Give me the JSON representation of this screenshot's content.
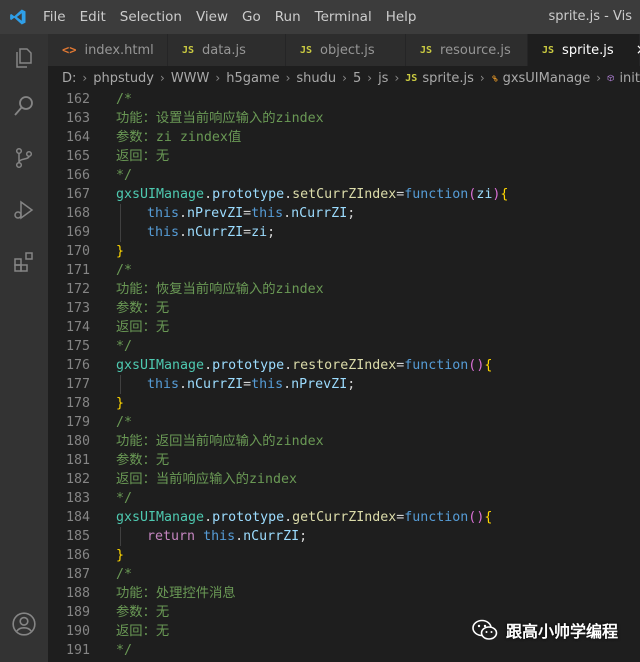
{
  "menu": [
    "File",
    "Edit",
    "Selection",
    "View",
    "Go",
    "Run",
    "Terminal",
    "Help"
  ],
  "window_title": "sprite.js - Vis",
  "tabs": [
    {
      "label": "index.html",
      "icon": "<>",
      "active": false
    },
    {
      "label": "data.js",
      "icon": "JS",
      "active": false
    },
    {
      "label": "object.js",
      "icon": "JS",
      "active": false
    },
    {
      "label": "resource.js",
      "icon": "JS",
      "active": false
    },
    {
      "label": "sprite.js",
      "icon": "JS",
      "active": true
    }
  ],
  "tab_close_glyph": "×",
  "breadcrumb": [
    "D:",
    "phpstudy",
    "WWW",
    "h5game",
    "shudu",
    "5",
    "js",
    "sprite.js",
    "gxsUIManage",
    "init"
  ],
  "activity_icons": [
    "explorer-icon",
    "search-icon",
    "source-control-icon",
    "run-debug-icon",
    "extensions-icon",
    "account-icon"
  ],
  "colors": {
    "accent": "#007acc",
    "editor_bg": "#1e1e1e",
    "comment": "#6a9955",
    "keyword": "#569cd6",
    "class": "#4ec9b0",
    "property": "#9cdcfe",
    "function": "#dcdcaa"
  },
  "editor": {
    "lines": [
      {
        "n": "162",
        "text": "/*"
      },
      {
        "n": "163",
        "text": "功能：设置当前响应输入的zindex"
      },
      {
        "n": "164",
        "text": "参数：zi zindex值"
      },
      {
        "n": "165",
        "text": "返回：无"
      },
      {
        "n": "166",
        "text": "*/"
      },
      {
        "n": "167",
        "text": "gxsUIManage.prototype.setCurrZIndex=function(zi){"
      },
      {
        "n": "168",
        "text": "this.nPrevZI=this.nCurrZI;"
      },
      {
        "n": "169",
        "text": "this.nCurrZI=zi;"
      },
      {
        "n": "170",
        "text": "}"
      },
      {
        "n": "171",
        "text": "/*"
      },
      {
        "n": "172",
        "text": "功能：恢复当前响应输入的zindex"
      },
      {
        "n": "173",
        "text": "参数：无"
      },
      {
        "n": "174",
        "text": "返回：无"
      },
      {
        "n": "175",
        "text": "*/"
      },
      {
        "n": "176",
        "text": "gxsUIManage.prototype.restoreZIndex=function(){"
      },
      {
        "n": "177",
        "text": "this.nCurrZI=this.nPrevZI;"
      },
      {
        "n": "178",
        "text": "}"
      },
      {
        "n": "179",
        "text": "/*"
      },
      {
        "n": "180",
        "text": "功能：返回当前响应输入的zindex"
      },
      {
        "n": "181",
        "text": "参数：无"
      },
      {
        "n": "182",
        "text": "返回：当前响应输入的zindex"
      },
      {
        "n": "183",
        "text": "*/"
      },
      {
        "n": "184",
        "text": "gxsUIManage.prototype.getCurrZIndex=function(){"
      },
      {
        "n": "185",
        "text": "return this.nCurrZI;"
      },
      {
        "n": "186",
        "text": "}"
      },
      {
        "n": "187",
        "text": "/*"
      },
      {
        "n": "188",
        "text": "功能：处理控件消息"
      },
      {
        "n": "189",
        "text": "参数：无"
      },
      {
        "n": "190",
        "text": "返回：无"
      },
      {
        "n": "191",
        "text": "*/"
      }
    ]
  },
  "watermark": "跟高小帅学编程"
}
